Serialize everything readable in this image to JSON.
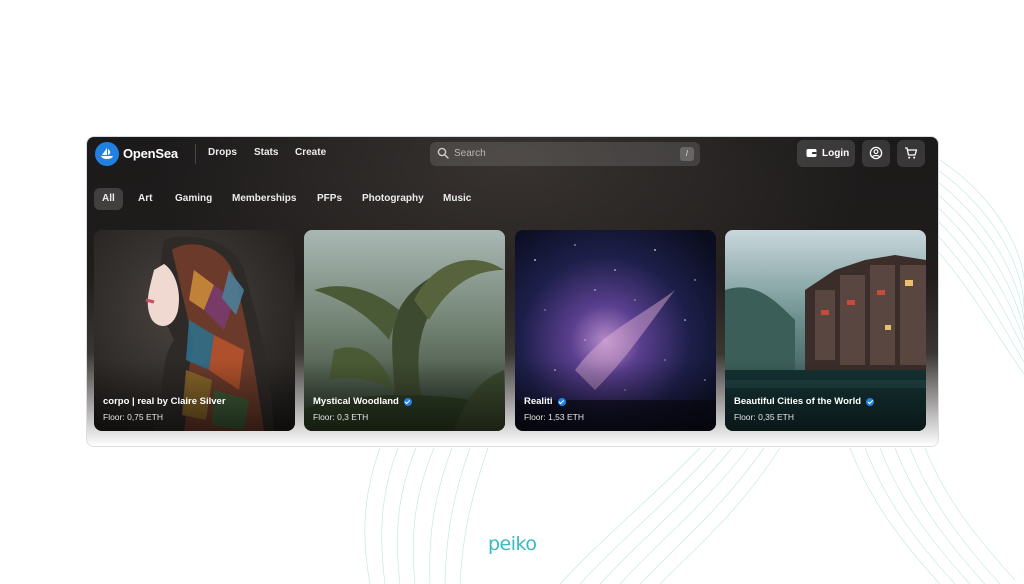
{
  "header": {
    "brand": "OpenSea",
    "nav": [
      "Drops",
      "Stats",
      "Create"
    ],
    "search_placeholder": "Search",
    "search_shortcut": "/",
    "login_label": "Login"
  },
  "categories": [
    "All",
    "Art",
    "Gaming",
    "Memberships",
    "PFPs",
    "Photography",
    "Music"
  ],
  "active_category": "All",
  "collections": [
    {
      "name": "corpo | real by Claire Silver",
      "floor": "Floor: 0,75 ETH",
      "verified": false
    },
    {
      "name": "Mystical Woodland",
      "floor": "Floor: 0,3 ETH",
      "verified": true
    },
    {
      "name": "Realiti",
      "floor": "Floor: 1,53 ETH",
      "verified": true
    },
    {
      "name": "Beautiful Cities of the World",
      "floor": "Floor: 0,35 ETH",
      "verified": true
    }
  ],
  "footer_brand": "peiko",
  "colors": {
    "accent": "#2081e2",
    "footer_brand": "#39b9c3",
    "waves": "#9fdcd6"
  },
  "icons": [
    "opensea-logo-icon",
    "search-icon",
    "wallet-icon",
    "account-icon",
    "cart-icon",
    "verified-badge-icon"
  ]
}
